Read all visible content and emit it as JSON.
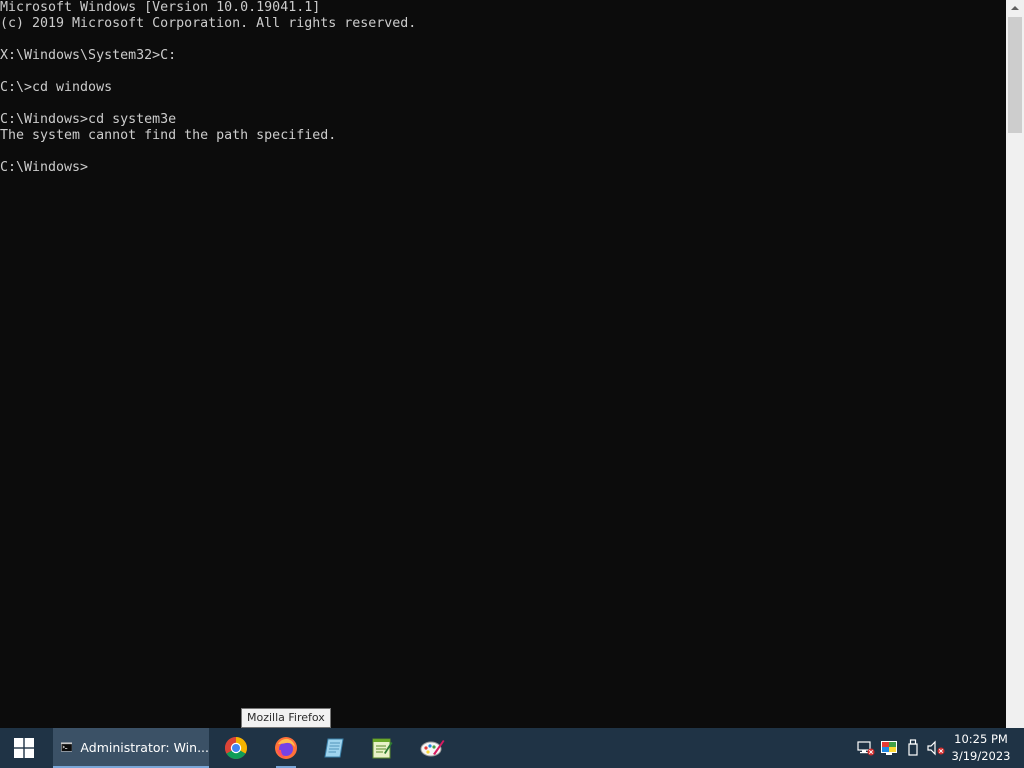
{
  "console": {
    "lines": [
      "Microsoft Windows [Version 10.0.19041.1]",
      "(c) 2019 Microsoft Corporation. All rights reserved.",
      "",
      "X:\\Windows\\System32>C:",
      "",
      "C:\\>cd windows",
      "",
      "C:\\Windows>cd system3e",
      "The system cannot find the path specified.",
      "",
      "C:\\Windows>"
    ]
  },
  "tooltip": {
    "text": "Mozilla Firefox"
  },
  "taskbar": {
    "active_task_label": "Administrator: Win...",
    "icons": [
      "windows-logo-icon",
      "cmd-icon",
      "chrome-icon",
      "firefox-icon",
      "notepad-icon",
      "text-editor-icon",
      "paint-icon"
    ],
    "accent_color": "#7aa7d8",
    "background_color": "#1f3345"
  },
  "tray": {
    "icons": [
      "network-disconnected-icon",
      "color-display-icon",
      "usb-drive-icon",
      "volume-muted-icon"
    ]
  },
  "clock": {
    "time": "10:25 PM",
    "date": "3/19/2023"
  }
}
